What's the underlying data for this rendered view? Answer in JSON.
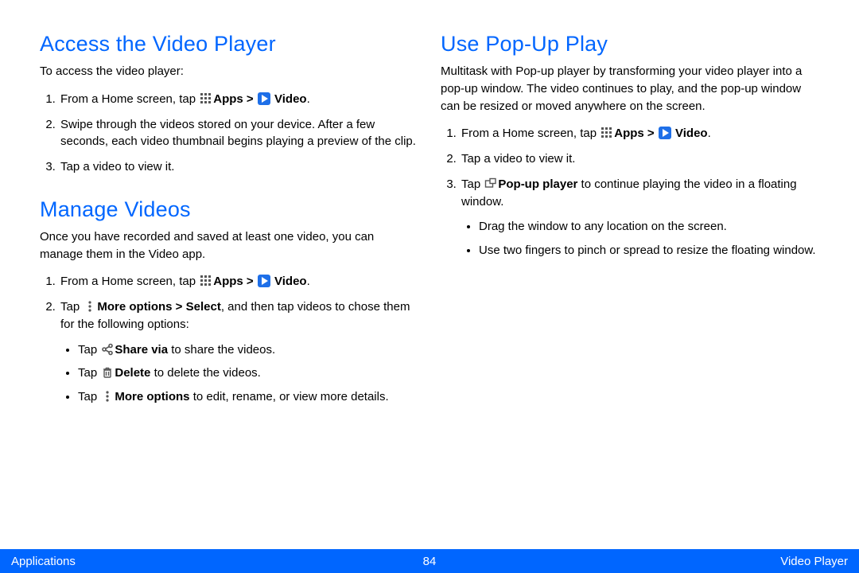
{
  "left": {
    "section1": {
      "heading": "Access the Video Player",
      "intro": "To access the video player:",
      "step1_a": "From a Home screen, tap ",
      "step1_apps": "Apps > ",
      "step1_video": " Video",
      "step1_end": ".",
      "step2": "Swipe through the videos stored on your device. After a few seconds, each video thumbnail begins playing a preview of the clip.",
      "step3": "Tap a video to view it."
    },
    "section2": {
      "heading": "Manage Videos",
      "intro": "Once you have recorded and saved at least one video, you can manage them in the Video app.",
      "step1_a": "From a Home screen, tap ",
      "step1_apps": "Apps > ",
      "step1_video": " Video",
      "step1_end": ".",
      "step2_a": "Tap ",
      "step2_more": "More options > Select",
      "step2_b": ", and then tap videos to chose them for the following options:",
      "b1_a": "Tap ",
      "b1_share": "Share via",
      "b1_b": " to share the videos.",
      "b2_a": "Tap ",
      "b2_delete": "Delete ",
      "b2_b": " to delete the videos.",
      "b3_a": "Tap ",
      "b3_more": "More options",
      "b3_b": " to edit, rename, or view more details."
    }
  },
  "right": {
    "heading": "Use Pop-Up Play",
    "intro": "Multitask with Pop-up player by transforming your video player into a pop-up window. The video continues to play, and the pop-up window can be resized or moved anywhere on the screen.",
    "step1_a": "From a Home screen, tap ",
    "step1_apps": "Apps > ",
    "step1_video": " Video",
    "step1_end": ".",
    "step2": "Tap a video to view it.",
    "step3_a": "Tap ",
    "step3_popup": "Pop-up player",
    "step3_b": " to continue playing the video in a floating window.",
    "b1": "Drag the window to any location on the screen.",
    "b2": "Use two fingers to pinch or spread to resize the floating window."
  },
  "footer": {
    "left": "Applications",
    "page": "84",
    "right": "Video Player"
  }
}
